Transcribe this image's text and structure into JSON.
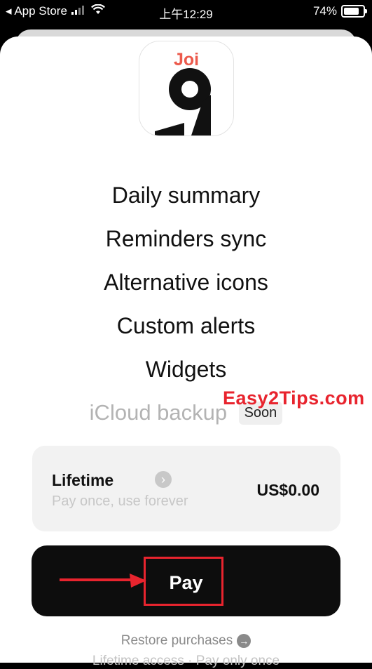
{
  "status_bar": {
    "carrier": "◂ App Store",
    "time": "上午12:29",
    "battery": "74%"
  },
  "app": {
    "icon_brand": "Joi",
    "icon_glyph": "9"
  },
  "features": {
    "items": [
      "Daily summary",
      "Reminders sync",
      "Alternative icons",
      "Custom alerts",
      "Widgets"
    ],
    "coming": "iCloud backup",
    "soon_badge": "Soon"
  },
  "watermark": "Easy2Tips.com",
  "plan": {
    "title": "Lifetime",
    "subtitle": "Pay once, use forever",
    "price": "US$0.00"
  },
  "pay_button": {
    "label": "Pay"
  },
  "restore": {
    "label": "Restore purchases"
  },
  "footnote": "Lifetime access · Pay only once",
  "colors": {
    "accent": "#ec5a4c",
    "annotation": "#e8242e",
    "button": "#0d0d0d"
  }
}
